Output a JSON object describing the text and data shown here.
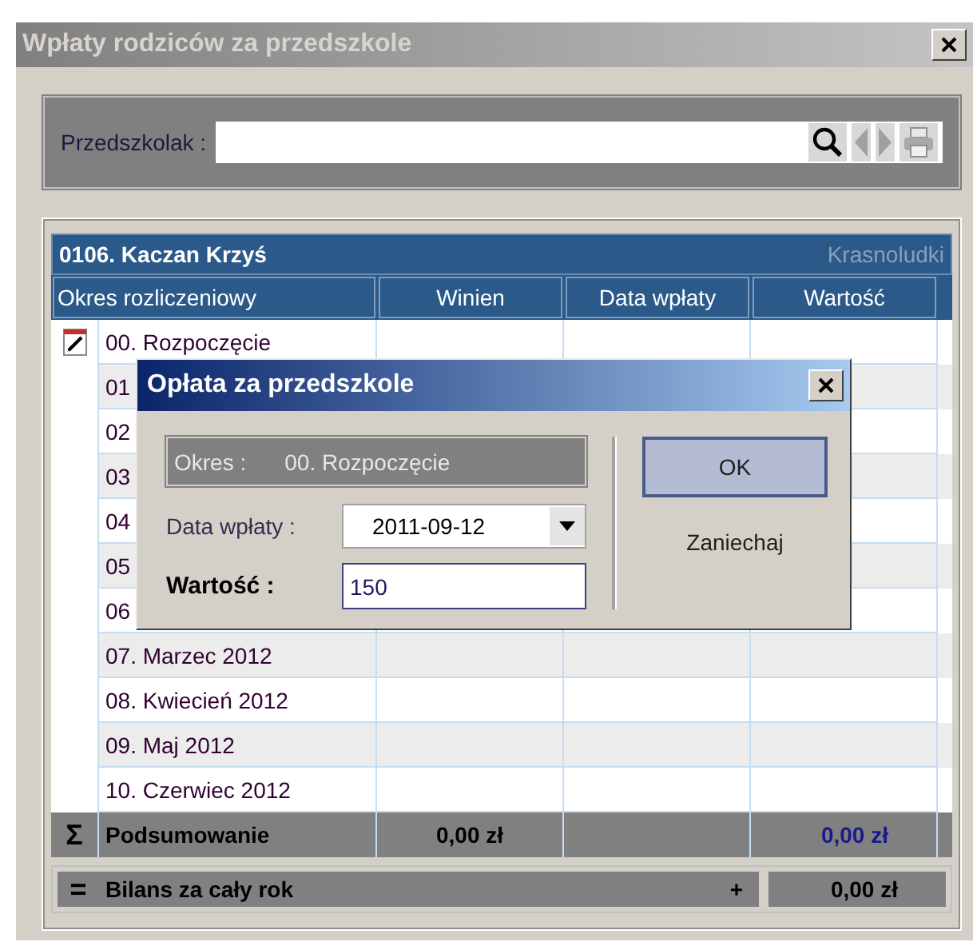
{
  "window": {
    "title": "Wpłaty rodziców za przedszkole"
  },
  "search": {
    "label": "Przedszkolak :"
  },
  "grid": {
    "child": "0106. Kaczan Krzyś",
    "group": "Krasnoludki",
    "columns": [
      "Okres rozliczeniowy",
      "Winien",
      "Data wpłaty",
      "Wartość"
    ],
    "rows": [
      {
        "period": "00. Rozpoczęcie",
        "current": true
      },
      {
        "period": "01",
        "current": false
      },
      {
        "period": "02",
        "current": false
      },
      {
        "period": "03",
        "current": false
      },
      {
        "period": "04",
        "current": false
      },
      {
        "period": "05",
        "current": false
      },
      {
        "period": "06",
        "current": false
      },
      {
        "period": "07. Marzec 2012",
        "current": false
      },
      {
        "period": "08. Kwiecień 2012",
        "current": false
      },
      {
        "period": "09. Maj 2012",
        "current": false
      },
      {
        "period": "10. Czerwiec 2012",
        "current": false
      }
    ],
    "summary": {
      "symbol": "Σ",
      "label": "Podsumowanie",
      "winien": "0,00 zł",
      "wartosc": "0,00 zł"
    },
    "balance": {
      "symbol": "=",
      "label": "Bilans za cały rok",
      "sign": "+",
      "value": "0,00 zł"
    }
  },
  "dialog": {
    "title": "Opłata za przedszkole",
    "period_label": "Okres :",
    "period": "00. Rozpoczęcie",
    "date_label": "Data wpłaty :",
    "date": "2011-09-12",
    "amount_label": "Wartość :",
    "amount": "150",
    "ok": "OK",
    "cancel": "Zaniechaj"
  }
}
